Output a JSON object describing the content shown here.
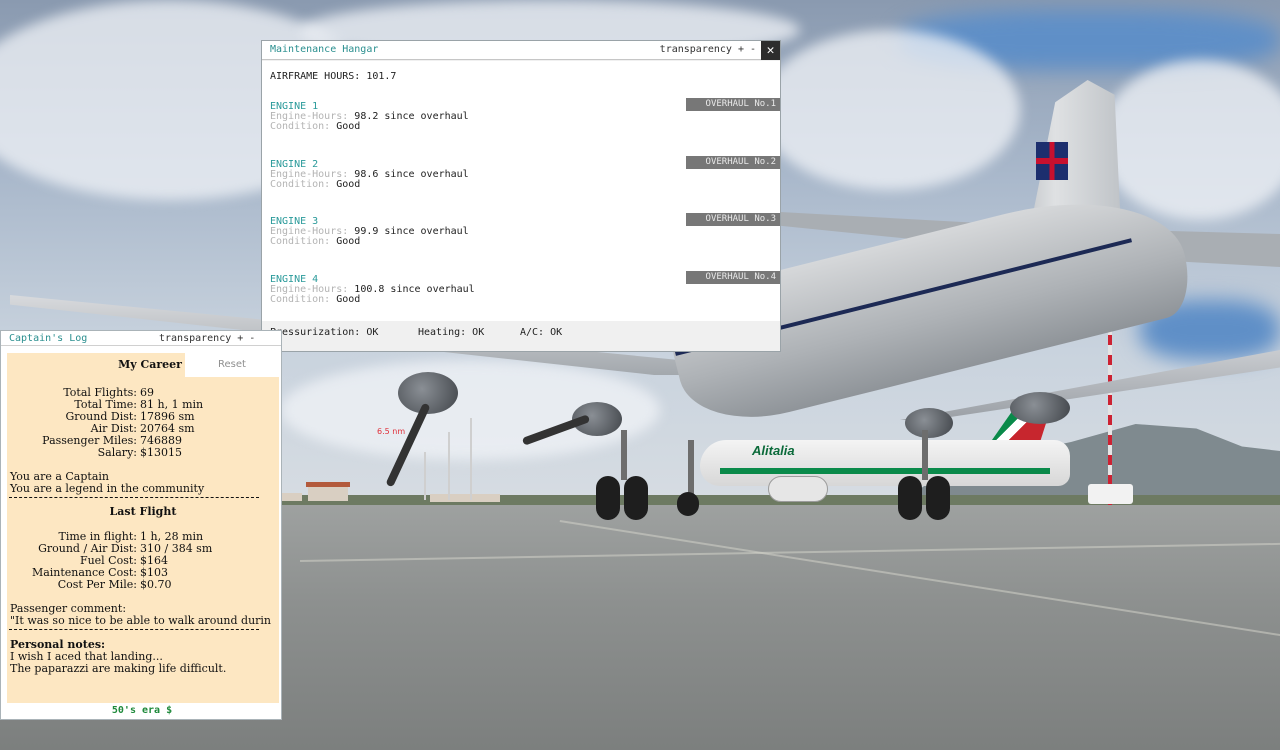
{
  "hangar": {
    "title": "Maintenance Hangar",
    "transparency": "transparency + -",
    "close_glyph": "✕",
    "airframe_hours": "AIRFRAME HOURS: 101.7",
    "hours_label": "Engine-Hours: ",
    "condition_label": "Condition: ",
    "engines": [
      {
        "name": "ENGINE 1",
        "hours": "98.2 since overhaul",
        "condition": "Good",
        "overhaul": "OVERHAUL No.1"
      },
      {
        "name": "ENGINE 2",
        "hours": "98.6 since overhaul",
        "condition": "Good",
        "overhaul": "OVERHAUL No.2"
      },
      {
        "name": "ENGINE 3",
        "hours": "99.9 since overhaul",
        "condition": "Good",
        "overhaul": "OVERHAUL No.3"
      },
      {
        "name": "ENGINE 4",
        "hours": "100.8 since overhaul",
        "condition": "Good",
        "overhaul": "OVERHAUL No.4"
      }
    ],
    "systems": {
      "pressurization": "Pressurization: OK",
      "heating": "Heating: OK",
      "ac": "A/C: OK"
    }
  },
  "captain": {
    "title": "Captain's Log",
    "transparency": "transparency + -",
    "tab_my_career": "My Career",
    "tab_reset": "Reset",
    "career": [
      {
        "label": "Total Flights:",
        "value": "69"
      },
      {
        "label": "Total Time:",
        "value": "81 h, 1 min"
      },
      {
        "label": "Ground Dist:",
        "value": "17896 sm"
      },
      {
        "label": "Air Dist:",
        "value": "20764 sm"
      },
      {
        "label": "Passenger Miles:",
        "value": "746889"
      },
      {
        "label": "Salary:",
        "value": "$13015"
      }
    ],
    "rank_line": "You are a Captain",
    "legend_line": "You are a legend in the community",
    "last_flight_title": "Last Flight",
    "last_flight": [
      {
        "label": "Time in flight:",
        "value": "1 h, 28 min"
      },
      {
        "label": "Ground / Air Dist:",
        "value": "310 / 384 sm"
      },
      {
        "label": "Fuel Cost:",
        "value": "$164"
      },
      {
        "label": "Maintenance Cost:",
        "value": "$103"
      },
      {
        "label": "Cost Per Mile:",
        "value": "$0.70"
      }
    ],
    "comment_label": "Passenger comment:",
    "comment_text": "\"It was so nice to be able to walk around durin",
    "notes_label": "Personal notes:",
    "notes_line1": "I wish I aced that landing...",
    "notes_line2": "The paparazzi are making life difficult.",
    "era": "50's era $"
  },
  "scene": {
    "jet_livery": "Alitalia",
    "distance_label": "6.5 nm",
    "icons": [
      "close-icon"
    ]
  }
}
